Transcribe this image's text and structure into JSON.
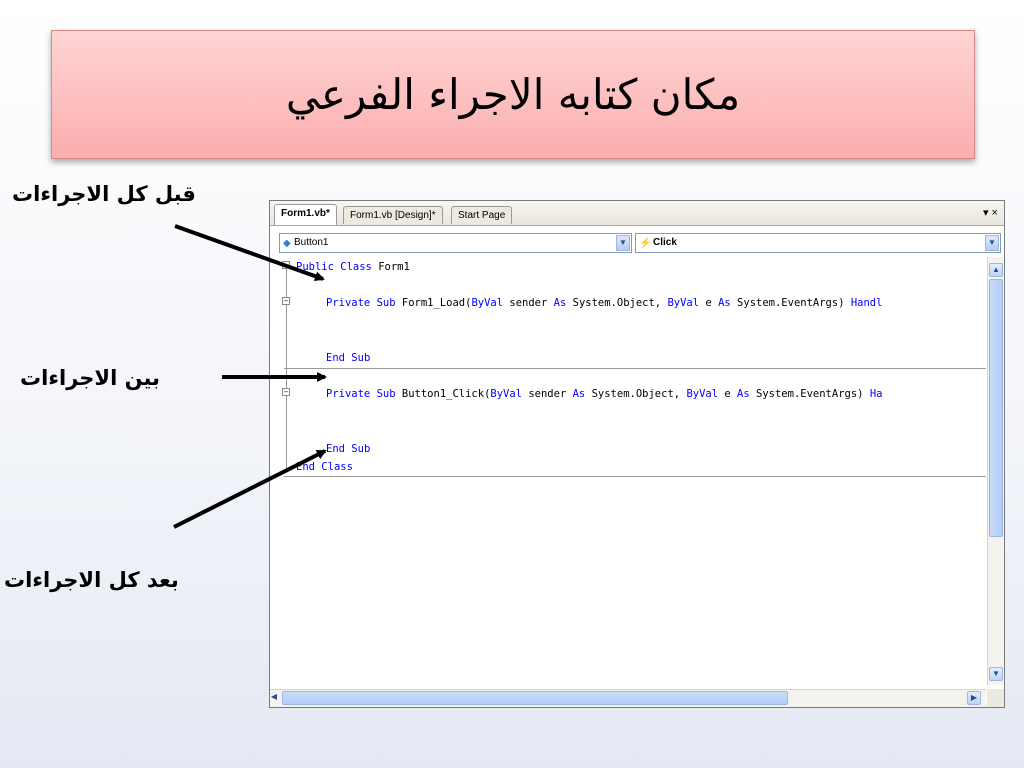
{
  "slide": {
    "title": "مكان كتابه الاجراء الفرعي",
    "label_before": "قبل كل الاجراءات",
    "label_between": "بين الاجراءات",
    "label_after": "بعد كل الاجراءات"
  },
  "ide": {
    "tabs": [
      {
        "label": "Form1.vb*",
        "active": true
      },
      {
        "label": "Form1.vb [Design]*",
        "active": false
      },
      {
        "label": "Start Page",
        "active": false
      }
    ],
    "tab_controls": "▾ ×",
    "object_combo": {
      "value": "Button1",
      "icon": "component-icon"
    },
    "event_combo": {
      "value": "Click",
      "icon": "lightning-event-icon"
    },
    "code": {
      "line1": {
        "kw1": "Public",
        "kw2": "Class",
        "rest": "Form1"
      },
      "line2": {
        "kw1": "Private",
        "kw2": "Sub",
        "p1": "Form1_Load(",
        "kw3": "ByVal",
        "p2": "sender",
        "kw4": "As",
        "p3": "System.Object,",
        "kw5": "ByVal",
        "p4": "e",
        "kw6": "As",
        "p5": "System.EventArgs)",
        "kw7": "Handl"
      },
      "line3": {
        "kw1": "End",
        "kw2": "Sub"
      },
      "line4": {
        "kw1": "Private",
        "kw2": "Sub",
        "p1": "Button1_Click(",
        "kw3": "ByVal",
        "p2": "sender",
        "kw4": "As",
        "p3": "System.Object,",
        "kw5": "ByVal",
        "p4": "e",
        "kw6": "As",
        "p5": "System.EventArgs)",
        "kw7": "Ha"
      },
      "line5": {
        "kw1": "End",
        "kw2": "Sub"
      },
      "line6": {
        "kw1": "End",
        "kw2": "Class"
      }
    }
  }
}
